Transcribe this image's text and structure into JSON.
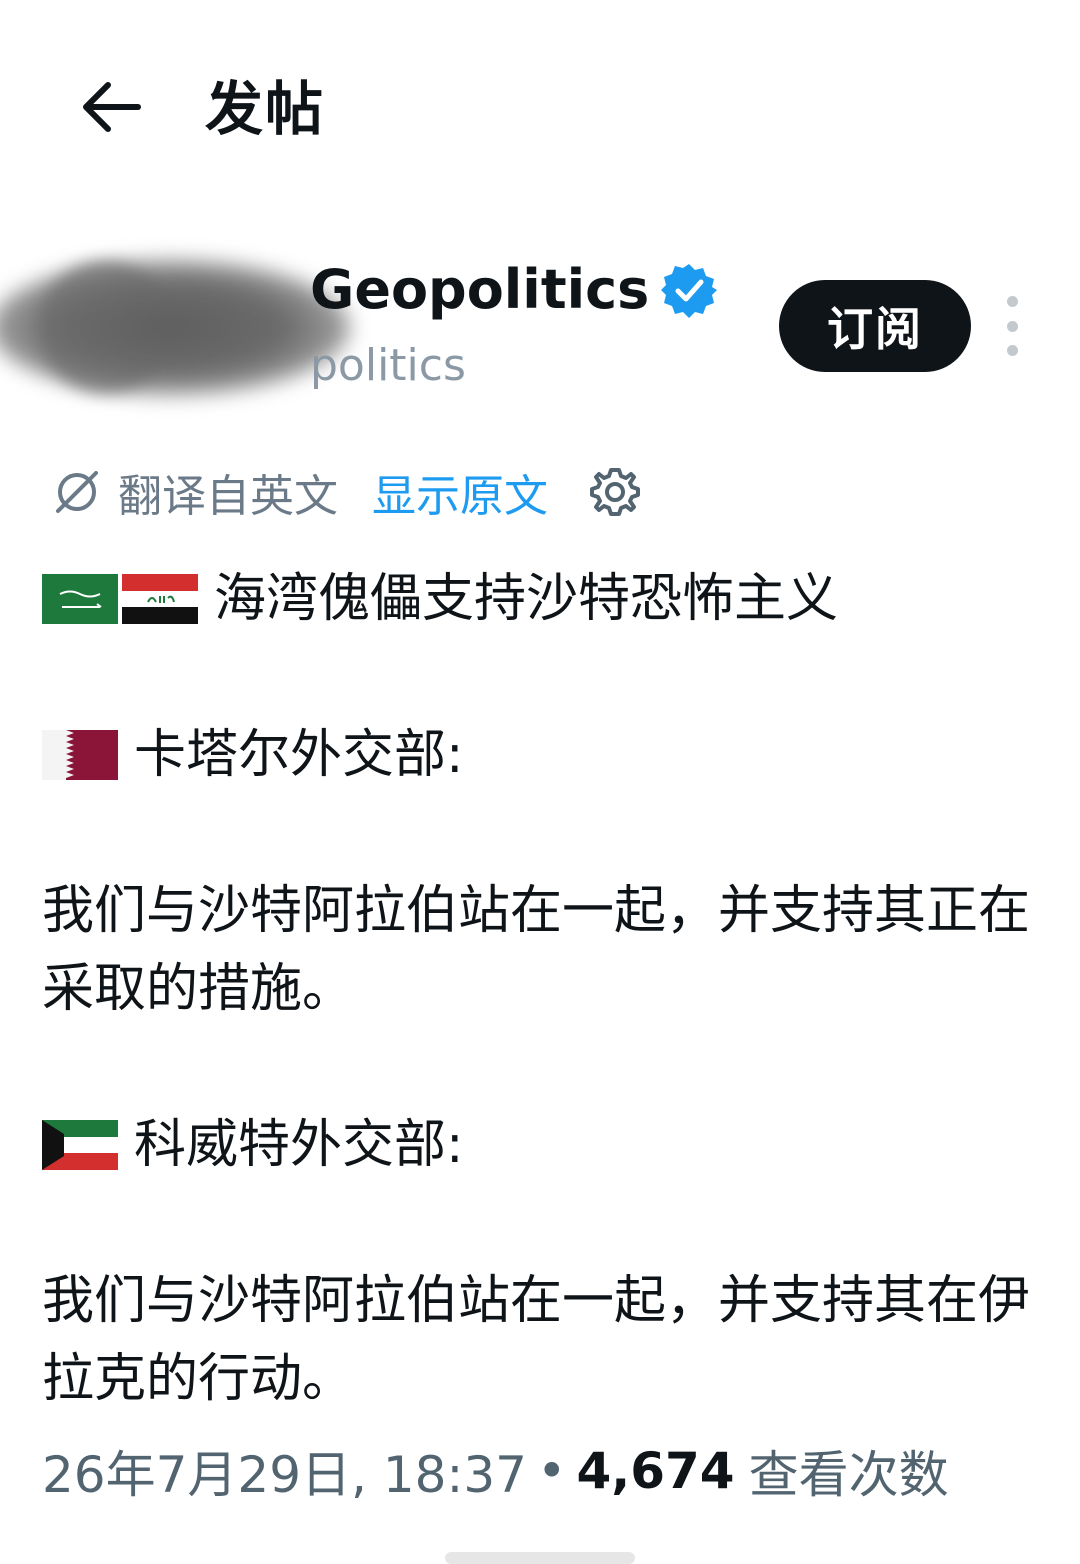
{
  "header": {
    "title": "发帖"
  },
  "author": {
    "display_name": "Geopolitics",
    "handle": "politics",
    "subscribe_label": "订阅"
  },
  "translation": {
    "translated_label": "翻译自英文",
    "show_original_label": "显示原文"
  },
  "post": {
    "line1": "海湾傀儡支持沙特恐怖主义",
    "qatar_heading": "卡塔尔外交部:",
    "qatar_statement": "我们与沙特阿拉伯站在一起，并支持其正在采取的措施。",
    "kuwait_heading": "科威特外交部:",
    "kuwait_statement": "我们与沙特阿拉伯站在一起，并支持其在伊拉克的行动。"
  },
  "meta": {
    "timestamp": "26年7月29日, 18:37",
    "separator": "•",
    "views": "4,674",
    "views_label": "查看次数"
  },
  "colors": {
    "link_blue": "#1d9bf0",
    "muted_gray": "#536471",
    "text": "#0f1419"
  }
}
